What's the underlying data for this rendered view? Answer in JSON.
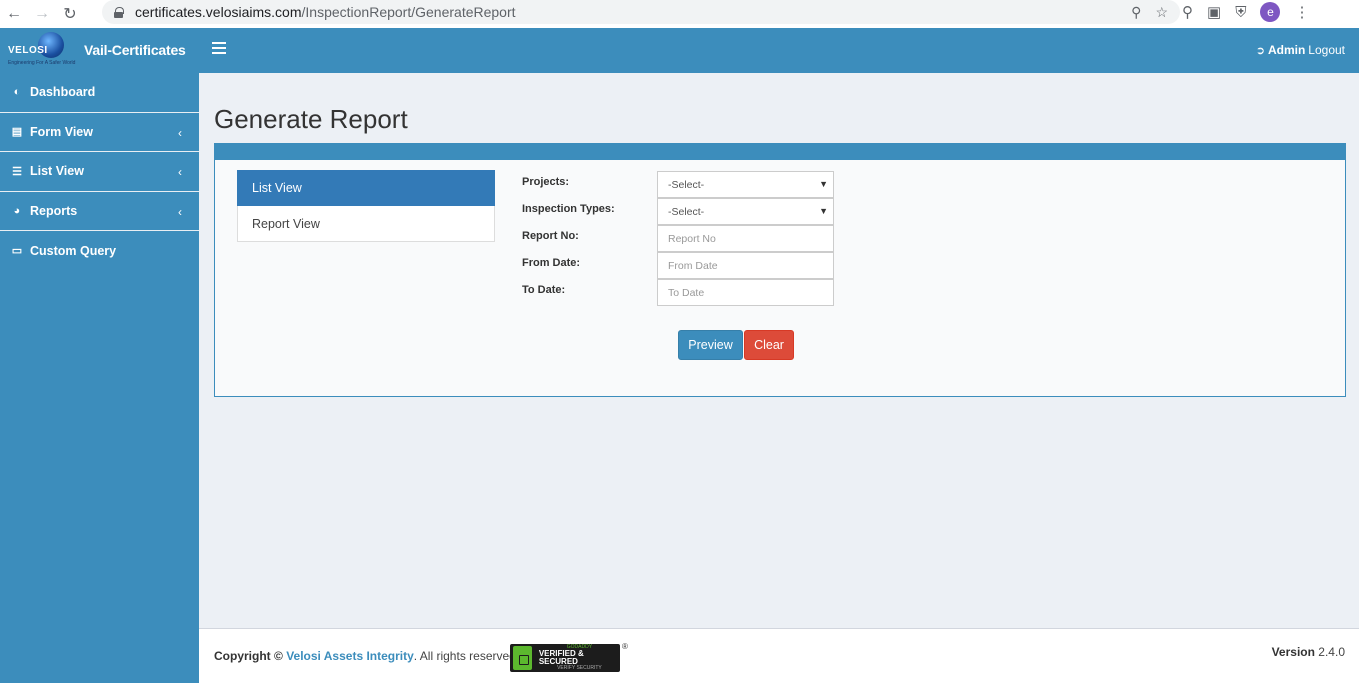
{
  "browser": {
    "url_host": "certificates.velosiaims.com",
    "url_path": "/InspectionReport/GenerateReport",
    "profile_initial": "e"
  },
  "header": {
    "logo_word": "VELOSI",
    "logo_tagline": "Engineering For A Safer World",
    "brand": "Vail-Certificates",
    "user": "Admin",
    "logout": "Logout"
  },
  "sidebar": {
    "items": [
      {
        "label": "Dashboard",
        "icon": "dashboard-icon",
        "has_children": false
      },
      {
        "label": "Form View",
        "icon": "form-icon",
        "has_children": true
      },
      {
        "label": "List View",
        "icon": "list-icon",
        "has_children": true
      },
      {
        "label": "Reports",
        "icon": "pie-chart-icon",
        "has_children": true
      },
      {
        "label": "Custom Query",
        "icon": "laptop-icon",
        "has_children": false
      }
    ]
  },
  "main": {
    "title": "Generate Report",
    "view_tabs": [
      {
        "label": "List View",
        "active": true
      },
      {
        "label": "Report View",
        "active": false
      }
    ],
    "form": {
      "projects_label": "Projects:",
      "projects_value": "-Select-",
      "inspection_types_label": "Inspection Types:",
      "inspection_types_value": "-Select-",
      "report_no_label": "Report No:",
      "report_no_placeholder": "Report No",
      "from_date_label": "From Date:",
      "from_date_placeholder": "From Date",
      "to_date_label": "To Date:",
      "to_date_placeholder": "To Date"
    },
    "buttons": {
      "preview": "Preview",
      "clear": "Clear"
    }
  },
  "footer": {
    "copyright_prefix": "Copyright ©",
    "company": "Velosi Assets Integrity",
    "rights": ". All rights reserved.",
    "seal_top": "GODADDY",
    "seal_mid": "VERIFIED & SECURED",
    "seal_bot": "VERIFY SECURITY",
    "version_label": "Version",
    "version_value": "2.4.0"
  },
  "colors": {
    "primary": "#3c8dbc",
    "active_tab": "#337ab7",
    "danger": "#dd4b39",
    "content_bg": "#ecf0f5"
  }
}
